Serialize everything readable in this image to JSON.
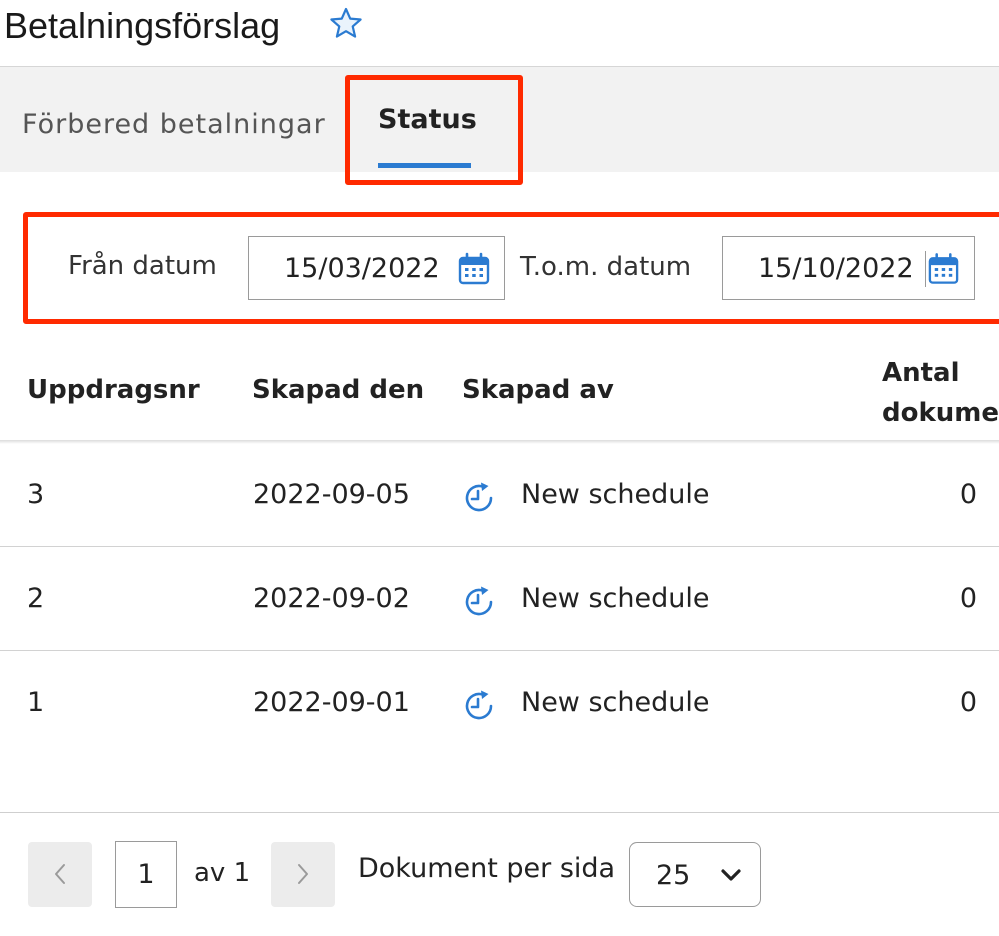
{
  "header": {
    "title": "Betalningsförslag"
  },
  "tabs": [
    {
      "label": "Förbered betalningar",
      "active": false
    },
    {
      "label": "Status",
      "active": true
    }
  ],
  "filter": {
    "from_label": "Från datum",
    "from_value": "15/03/2022",
    "to_label": "T.o.m. datum",
    "to_value": "15/10/2022"
  },
  "table": {
    "columns": [
      "Uppdragsnr",
      "Skapad den",
      "Skapad av",
      "Antal\ndokume"
    ],
    "rows": [
      {
        "nr": "3",
        "created": "2022-09-05",
        "by": "New schedule",
        "count": "0"
      },
      {
        "nr": "2",
        "created": "2022-09-02",
        "by": "New schedule",
        "count": "0"
      },
      {
        "nr": "1",
        "created": "2022-09-01",
        "by": "New schedule",
        "count": "0"
      }
    ]
  },
  "pagination": {
    "page": "1",
    "of_text": "av 1",
    "per_page_label": "Dokument per sida",
    "per_page_value": "25"
  },
  "colors": {
    "accent": "#2b7bd1",
    "highlight": "#ff2a00"
  },
  "icons": [
    "star-icon",
    "calendar-icon",
    "schedule-icon",
    "chevron-left-icon",
    "chevron-right-icon",
    "chevron-down-icon"
  ]
}
